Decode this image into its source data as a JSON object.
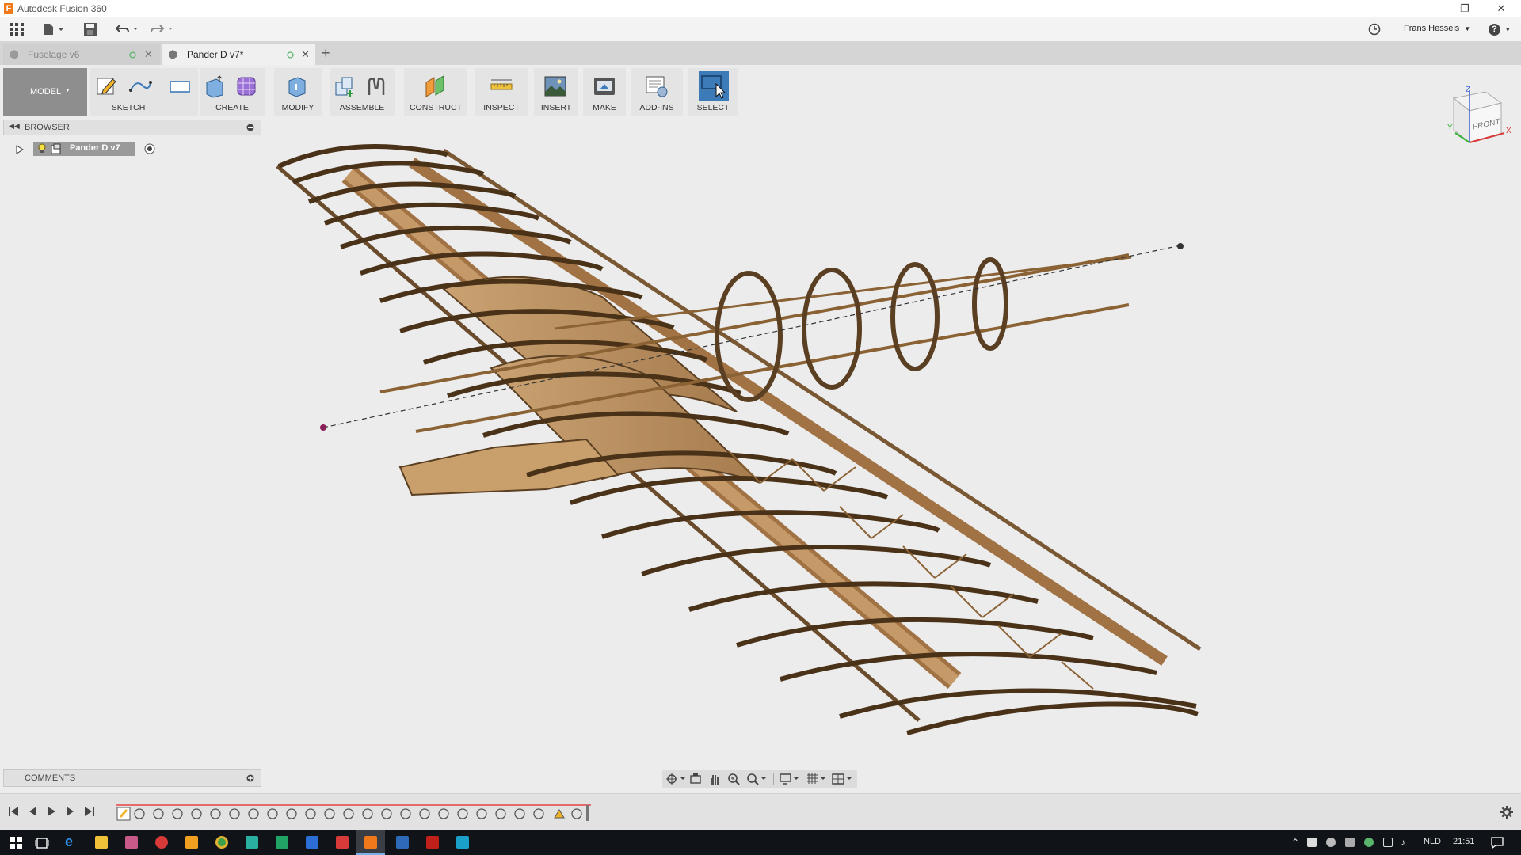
{
  "window": {
    "title": "Autodesk Fusion 360"
  },
  "appbar": {
    "user": "Frans Hessels"
  },
  "tabs": [
    {
      "label": "Fuselage v6",
      "active": false
    },
    {
      "label": "Pander D v7*",
      "active": true
    }
  ],
  "toolbar": {
    "workspace": "MODEL",
    "groups": [
      "SKETCH",
      "CREATE",
      "MODIFY",
      "ASSEMBLE",
      "CONSTRUCT",
      "INSPECT",
      "INSERT",
      "MAKE",
      "ADD-INS",
      "SELECT"
    ]
  },
  "browser": {
    "title": "BROWSER",
    "root": "Pander D v7"
  },
  "comments": {
    "title": "COMMENTS"
  },
  "viewcube": {
    "face": "FRONT",
    "axis_x": "X",
    "axis_y": "Y",
    "axis_z": "Z"
  },
  "taskbar": {
    "lang": "NLD",
    "time": "21:51"
  },
  "colors": {
    "wood": "#b48a5a",
    "wood_dark": "#5a3f22",
    "accent": "#3d7ab8"
  }
}
